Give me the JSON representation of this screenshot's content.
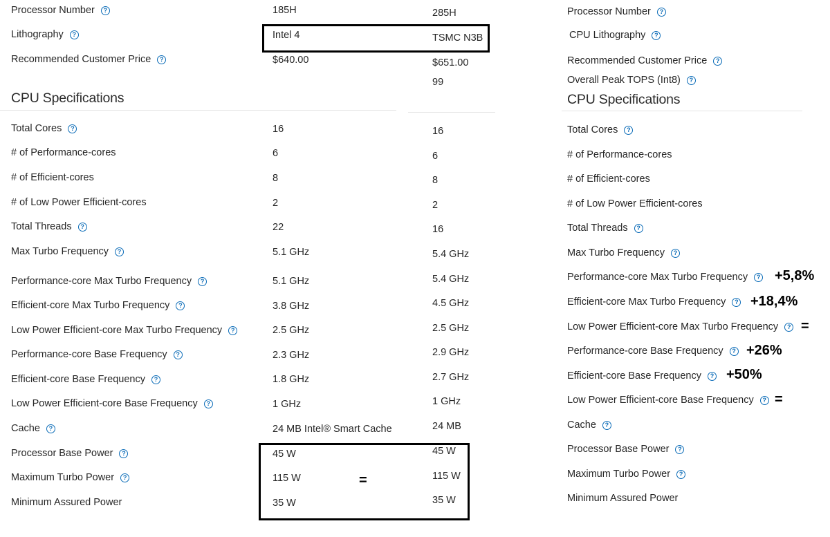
{
  "col1_rows": [
    {
      "label": "Processor Number",
      "help": true
    },
    {
      "label": "Lithography",
      "help": true
    },
    {
      "label": "Recommended Customer Price",
      "help": true
    },
    {
      "label": "Total Cores",
      "help": true
    },
    {
      "label": "# of Performance-cores",
      "help": false
    },
    {
      "label": "# of Efficient-cores",
      "help": false
    },
    {
      "label": "# of Low Power Efficient-cores",
      "help": false
    },
    {
      "label": "Total Threads",
      "help": true
    },
    {
      "label": "Max Turbo Frequency",
      "help": true
    },
    {
      "label": "Performance-core Max Turbo Frequency",
      "help": true
    },
    {
      "label": "Efficient-core Max Turbo Frequency",
      "help": true
    },
    {
      "label": "Low Power Efficient-core Max Turbo Frequency",
      "help": true
    },
    {
      "label": "Performance-core Base Frequency",
      "help": true
    },
    {
      "label": "Efficient-core Base Frequency",
      "help": true
    },
    {
      "label": "Low Power Efficient-core Base Frequency",
      "help": true
    },
    {
      "label": "Cache",
      "help": true
    },
    {
      "label": "Processor Base Power",
      "help": true
    },
    {
      "label": "Maximum Turbo Power",
      "help": true
    },
    {
      "label": "Minimum Assured Power",
      "help": false
    }
  ],
  "col1_section_title": "CPU Specifications",
  "col2_values": [
    "185H",
    "Intel 4",
    "$640.00",
    "16",
    "6",
    "8",
    "2",
    "22",
    "5.1 GHz",
    "5.1 GHz",
    "3.8 GHz",
    "2.5 GHz",
    "2.3 GHz",
    "1.8 GHz",
    "1 GHz",
    "24 MB Intel® Smart Cache",
    "45 W",
    "115 W",
    "35 W"
  ],
  "col3_values": [
    "285H",
    "TSMC N3B",
    "$651.00",
    "99",
    "16",
    "6",
    "8",
    "2",
    "16",
    "5.4 GHz",
    "5.4 GHz",
    "4.5 GHz",
    "2.5 GHz",
    "2.9 GHz",
    "2.7 GHz",
    "1 GHz",
    "24 MB",
    "45 W",
    "115 W",
    "35 W"
  ],
  "col4_rows": [
    {
      "label": "Processor Number",
      "help": true
    },
    {
      "label": "CPU Lithography",
      "help": true
    },
    {
      "label": "Recommended Customer Price",
      "help": true
    },
    {
      "label": "Overall Peak TOPS (Int8)",
      "help": true
    },
    {
      "label": "Total Cores",
      "help": true
    },
    {
      "label": "# of Performance-cores",
      "help": false
    },
    {
      "label": "# of Efficient-cores",
      "help": false
    },
    {
      "label": "# of Low Power Efficient-cores",
      "help": false
    },
    {
      "label": "Total Threads",
      "help": true
    },
    {
      "label": "Max Turbo Frequency",
      "help": true
    },
    {
      "label": "Performance-core Max Turbo Frequency",
      "help": true
    },
    {
      "label": "Efficient-core Max Turbo Frequency",
      "help": true
    },
    {
      "label": "Low Power Efficient-core Max Turbo Frequency",
      "help": true
    },
    {
      "label": "Performance-core Base Frequency",
      "help": true
    },
    {
      "label": "Efficient-core Base Frequency",
      "help": true
    },
    {
      "label": "Low Power Efficient-core Base Frequency",
      "help": true
    },
    {
      "label": "Cache",
      "help": true
    },
    {
      "label": "Processor Base Power",
      "help": true
    },
    {
      "label": "Maximum Turbo Power",
      "help": true
    },
    {
      "label": "Minimum Assured Power",
      "help": false
    }
  ],
  "col4_section_title": "CPU Specifications",
  "annotations": [
    "+5,8%",
    "+18,4%",
    "=",
    "+26%",
    "+50%",
    "=",
    "="
  ],
  "help_glyph": "?",
  "help_color": "#0b6cb8"
}
